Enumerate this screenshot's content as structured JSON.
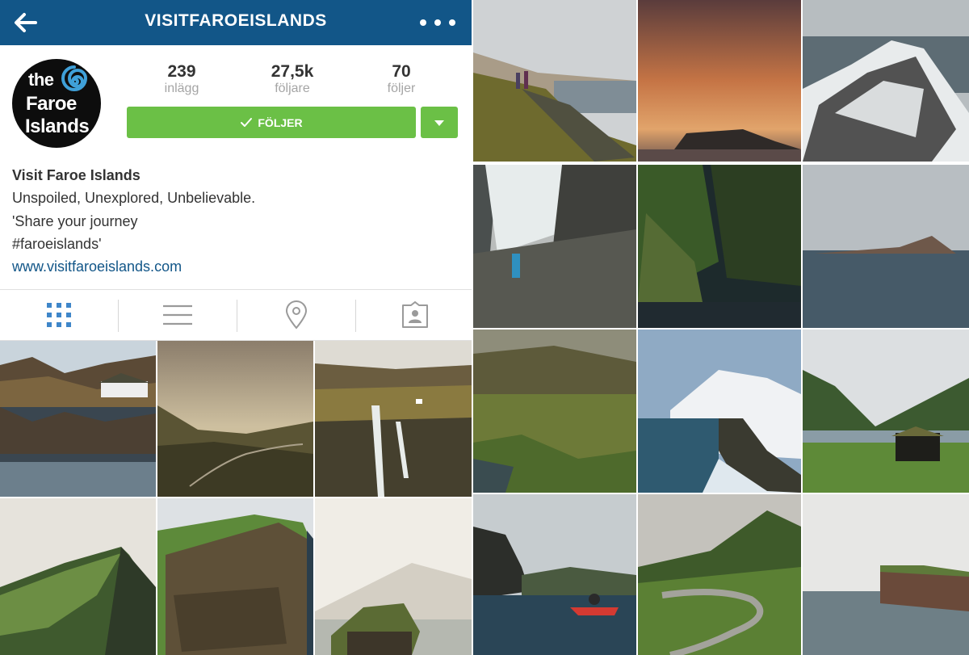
{
  "header": {
    "title": "VISITFAROEISLANDS",
    "back_icon": "arrow-left-icon",
    "more_icon": "more-dots-icon",
    "bar_color": "#125688"
  },
  "profile": {
    "avatar_text": {
      "line1": "the",
      "line2": "Faroe",
      "line3": "Islands"
    },
    "stats": [
      {
        "value": "239",
        "label": "inlägg"
      },
      {
        "value": "27,5k",
        "label": "följare"
      },
      {
        "value": "70",
        "label": "följer"
      }
    ],
    "follow_button": {
      "label": "FÖLJER",
      "icon": "checkmark-icon",
      "color": "#6bc046"
    },
    "dropdown_icon": "caret-down-icon"
  },
  "bio": {
    "name": "Visit Faroe Islands",
    "lines": [
      "Unspoiled, Unexplored, Unbelievable.",
      "'Share your journey",
      "#faroeislands'"
    ],
    "link": "www.visitfaroeislands.com"
  },
  "tabs": [
    {
      "name": "grid-view",
      "icon": "grid-icon",
      "active": true
    },
    {
      "name": "list-view",
      "icon": "list-icon",
      "active": false
    },
    {
      "name": "places",
      "icon": "location-pin-icon",
      "active": false
    },
    {
      "name": "tagged",
      "icon": "tagged-person-icon",
      "active": false
    }
  ],
  "photos": {
    "left_grid": [
      "lake-reflection-house",
      "misty-valley-road",
      "waterfall-cliff",
      "green-sea-cliff",
      "towering-rock-cliff",
      "turf-roof-cabin"
    ],
    "right_grid": [
      "coastal-hikers",
      "sunset-clouds-island",
      "snowy-ridge",
      "waterfall-climber",
      "green-cliffs-boat",
      "lone-island-sea",
      "valley-village",
      "snowy-mountain-coast",
      "turf-house-lake",
      "kayaker-cliffs",
      "winding-road-cyclist",
      "sea-stack-cliff"
    ]
  },
  "colors": {
    "accent_blue": "#125688",
    "follow_green": "#6bc046",
    "muted_gray": "#a5a5a5",
    "active_tab_blue": "#3f86c9"
  }
}
